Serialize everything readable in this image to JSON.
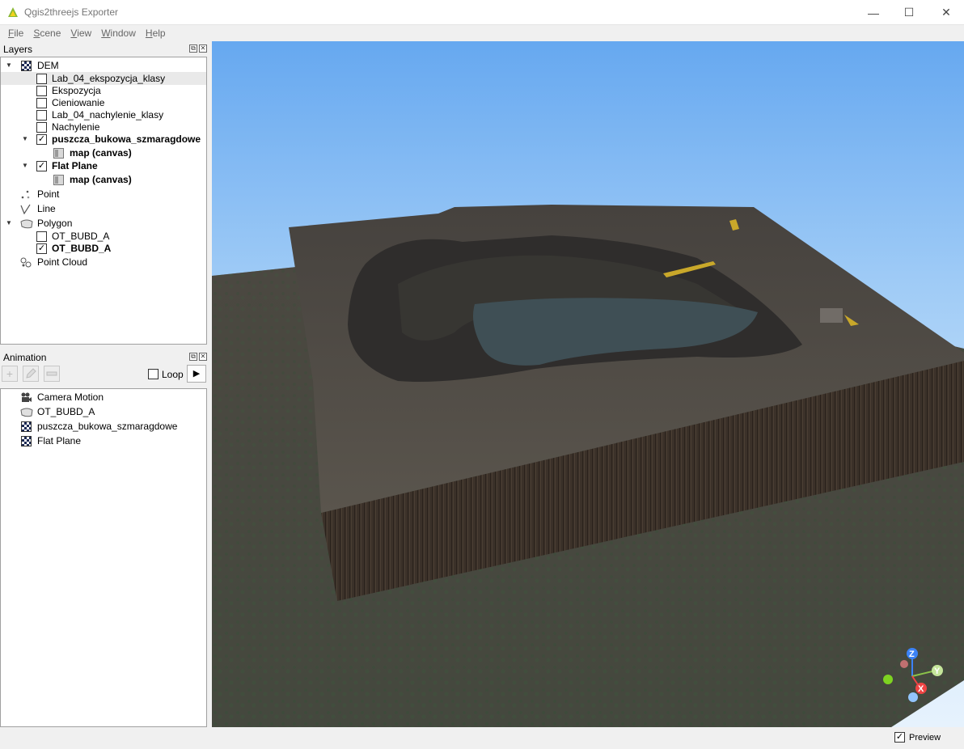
{
  "window": {
    "title": "Qgis2threejs Exporter",
    "minimize_glyph": "—",
    "maximize_glyph": "☐",
    "close_glyph": "✕"
  },
  "menu": [
    {
      "underline": "F",
      "rest": "ile"
    },
    {
      "underline": "S",
      "rest": "cene"
    },
    {
      "underline": "V",
      "rest": "iew"
    },
    {
      "underline": "W",
      "rest": "indow"
    },
    {
      "underline": "H",
      "rest": "elp"
    }
  ],
  "layers_panel": {
    "title": "Layers",
    "groups": {
      "dem": "DEM",
      "point": "Point",
      "line": "Line",
      "polygon": "Polygon",
      "point_cloud": "Point Cloud"
    },
    "dem_children": [
      {
        "label": "Lab_04_ekspozycja_klasy",
        "checked": false
      },
      {
        "label": "Ekspozycja",
        "checked": false
      },
      {
        "label": "Cieniowanie",
        "checked": false
      },
      {
        "label": "Lab_04_nachylenie_klasy",
        "checked": false
      },
      {
        "label": "Nachylenie",
        "checked": false
      },
      {
        "label": "puszcza_bukowa_szmaragdowe",
        "checked": true
      },
      {
        "label": "Flat Plane",
        "checked": true
      }
    ],
    "texture_label": "map (canvas)",
    "polygon_children": [
      {
        "label": "OT_BUBD_A",
        "checked": false
      },
      {
        "label": "OT_BUBD_A",
        "checked": true
      }
    ]
  },
  "animation_panel": {
    "title": "Animation",
    "loop_label": "Loop",
    "loop_checked": false,
    "play_glyph": "▶",
    "items": [
      {
        "label": "Camera Motion",
        "icon": "camera-icon"
      },
      {
        "label": "OT_BUBD_A",
        "icon": "polygon-icon"
      },
      {
        "label": "puszcza_bukowa_szmaragdowe",
        "icon": "dem-icon"
      },
      {
        "label": "Flat Plane",
        "icon": "dem-icon"
      }
    ]
  },
  "viewport": {
    "axis_labels": {
      "z": "Z",
      "y": "Y",
      "x": "X"
    },
    "colors": {
      "sky_top": "#66a8f0",
      "sky_bottom": "#e6f2fd",
      "terrain": "#4f4a44",
      "water": "#3f4f55",
      "wall": "#3a3028"
    }
  },
  "status": {
    "preview_label": "Preview",
    "preview_checked": true
  },
  "glyphs": {
    "check": "✓",
    "expand": "▼",
    "dock_float": "⧉",
    "dock_close": "✕"
  }
}
